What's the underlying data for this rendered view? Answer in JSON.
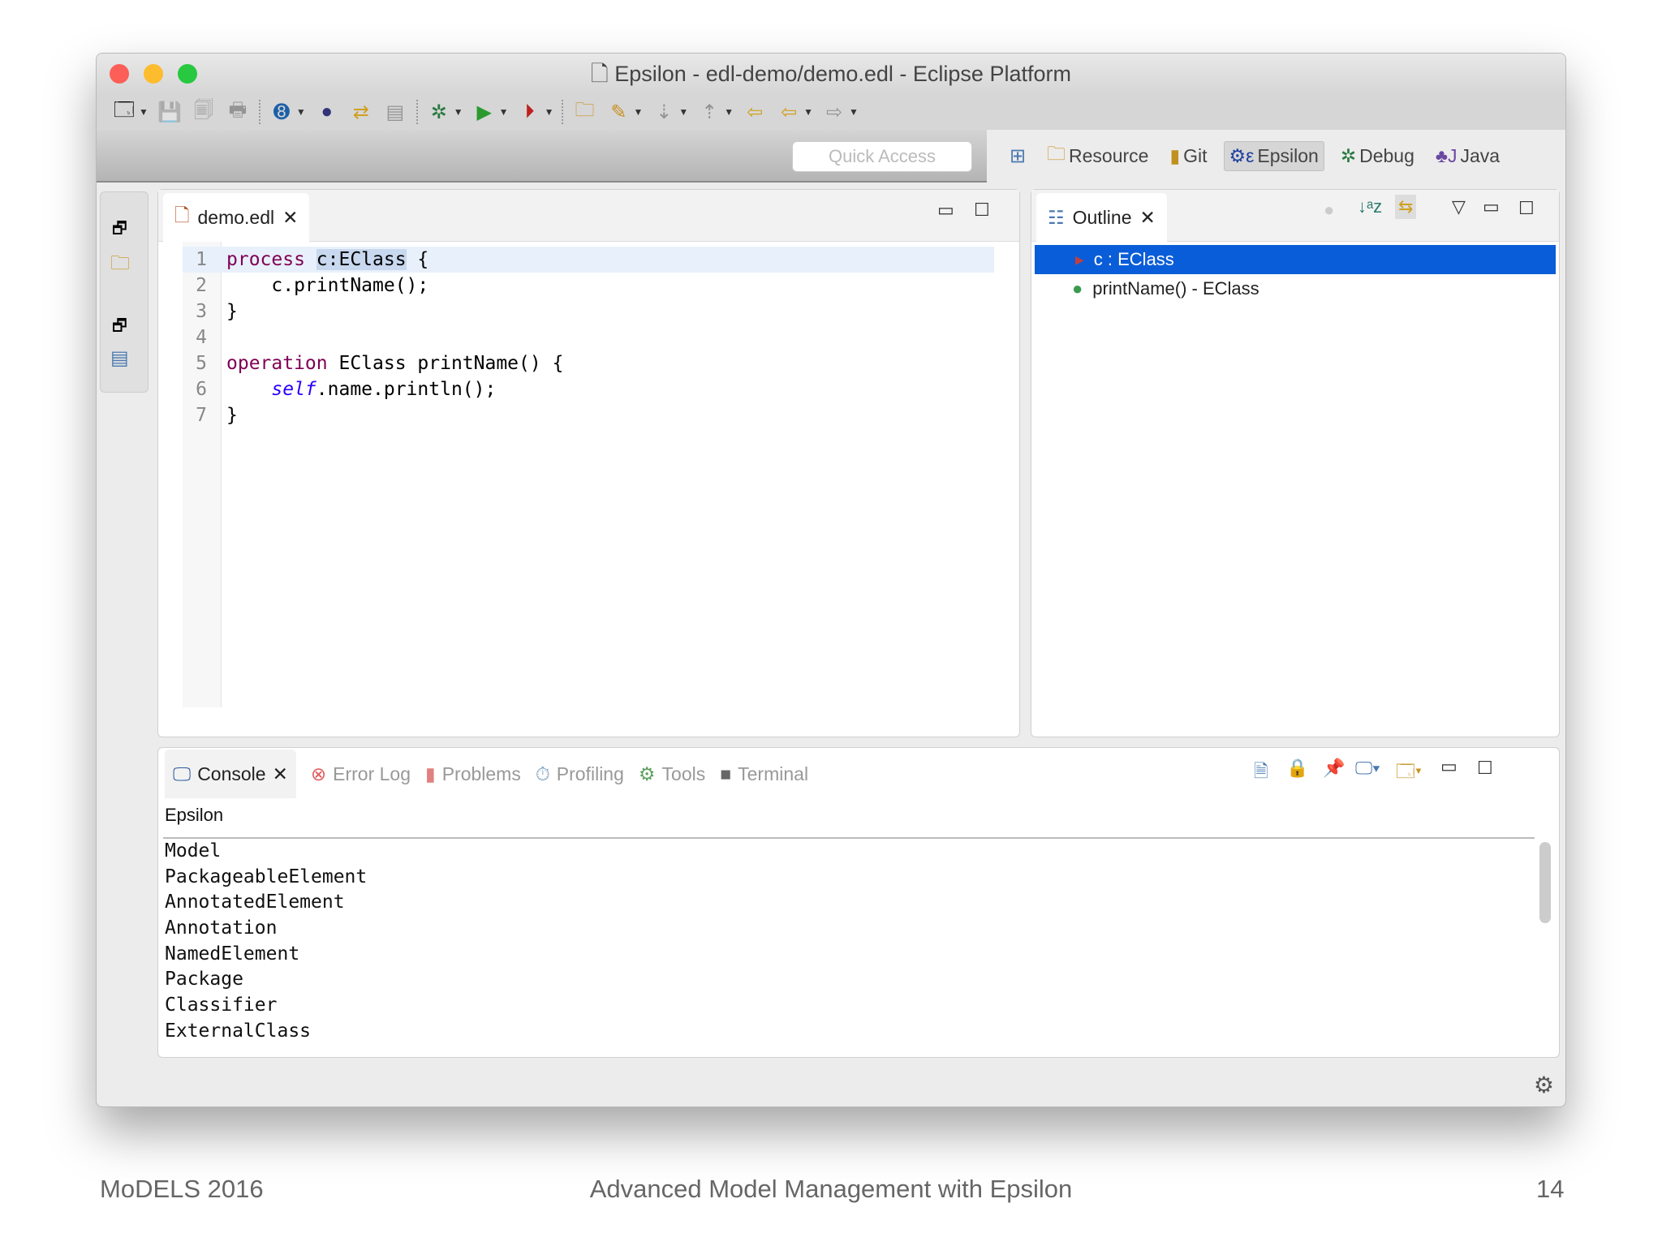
{
  "window": {
    "title": "Epsilon - edl-demo/demo.edl - Eclipse Platform"
  },
  "toolbar": {
    "quick_access_placeholder": "Quick Access"
  },
  "perspectives": [
    {
      "label": "Resource",
      "icon": "resource-perspective-icon"
    },
    {
      "label": "Git",
      "icon": "git-icon"
    },
    {
      "label": "Epsilon",
      "icon": "epsilon-icon",
      "active": true
    },
    {
      "label": "Debug",
      "icon": "bug-icon"
    },
    {
      "label": "Java",
      "icon": "java-icon"
    }
  ],
  "editor": {
    "tab_label": "demo.edl",
    "lines": [
      {
        "n": "1",
        "parts": [
          {
            "t": "process",
            "c": "kw"
          },
          {
            "t": " "
          },
          {
            "t": "c:EClass",
            "c": "sel"
          },
          {
            "t": " {"
          }
        ]
      },
      {
        "n": "2",
        "parts": [
          {
            "t": "    c.printName();"
          }
        ]
      },
      {
        "n": "3",
        "parts": [
          {
            "t": "}"
          }
        ]
      },
      {
        "n": "4",
        "parts": [
          {
            "t": ""
          }
        ]
      },
      {
        "n": "5",
        "parts": [
          {
            "t": "operation",
            "c": "kw"
          },
          {
            "t": " EClass printName() {"
          }
        ]
      },
      {
        "n": "6",
        "parts": [
          {
            "t": "    "
          },
          {
            "t": "self",
            "c": "it"
          },
          {
            "t": ".name.println();"
          }
        ]
      },
      {
        "n": "7",
        "parts": [
          {
            "t": "}"
          }
        ]
      }
    ]
  },
  "outline": {
    "tab_label": "Outline",
    "items": [
      {
        "label": "c : EClass",
        "selected": true
      },
      {
        "label": "printName() - EClass"
      }
    ]
  },
  "console": {
    "tabs": [
      "Console",
      "Error Log",
      "Problems",
      "Profiling",
      "Tools",
      "Terminal"
    ],
    "title": "Epsilon",
    "lines": [
      "Model",
      "PackageableElement",
      "AnnotatedElement",
      "Annotation",
      "NamedElement",
      "Package",
      "Classifier",
      "ExternalClass"
    ]
  },
  "footer": {
    "left": "MoDELS 2016",
    "center": "Advanced Model Management with Epsilon",
    "right": "14"
  },
  "colors": {
    "selection": "#0a5dd8",
    "keyword": "#7f0055"
  }
}
